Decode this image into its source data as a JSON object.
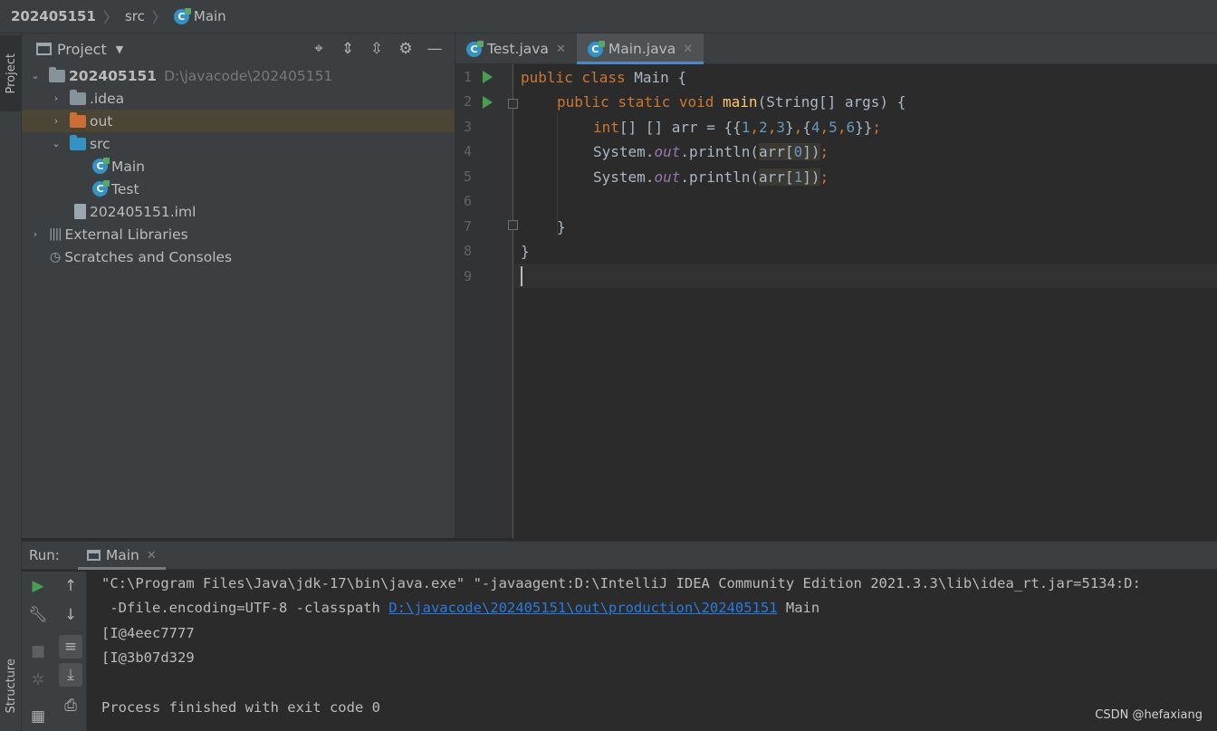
{
  "navbar": {
    "project": "202405151",
    "folder": "src",
    "file": "Main"
  },
  "left_strip": {
    "project_tab": "Project",
    "structure_tab": "Structure"
  },
  "project_panel": {
    "title": "Project",
    "tree": [
      {
        "label": "202405151",
        "path": "D:\\javacode\\202405151",
        "icon": "folder-icon"
      },
      {
        "label": ".idea",
        "icon": "folder-icon"
      },
      {
        "label": "out",
        "icon": "folder-orange-icon"
      },
      {
        "label": "src",
        "icon": "folder-blue-icon"
      },
      {
        "label": "Main",
        "icon": "java-class-icon"
      },
      {
        "label": "Test",
        "icon": "java-class-icon"
      },
      {
        "label": "202405151.iml",
        "icon": "iml-file-icon"
      },
      {
        "label": "External Libraries",
        "icon": "library-icon"
      },
      {
        "label": "Scratches and Consoles",
        "icon": "scratches-icon"
      }
    ]
  },
  "editor": {
    "tabs": [
      {
        "label": "Test.java",
        "active": false
      },
      {
        "label": "Main.java",
        "active": true
      }
    ],
    "line_numbers": [
      "1",
      "2",
      "3",
      "4",
      "5",
      "6",
      "7",
      "8",
      "9"
    ],
    "code": {
      "l1_kw": "public class ",
      "l1_rest": "Main {",
      "l2_kw": "public static void ",
      "l2_fn": "main",
      "l2_rest": "(String[] args) {",
      "l3_kw": "int",
      "l3_a": "[] [] arr = {{",
      "l3_n1": "1",
      "l3_c1": ",",
      "l3_n2": "2",
      "l3_c2": ",",
      "l3_n3": "3",
      "l3_b": "}",
      "l3_c3": ",",
      "l3_c": "{",
      "l3_n4": "4",
      "l3_c4": ",",
      "l3_n5": "5",
      "l3_c5": ",",
      "l3_n6": "6",
      "l3_d": "}}",
      "l3_semi": ";",
      "l4_a": "System.",
      "l4_out": "out",
      "l4_b": ".println(",
      "l4_arr": "arr[",
      "l4_idx": "0",
      "l4_c": "]",
      "l4_d": ")",
      "l4_semi": ";",
      "l5_a": "System.",
      "l5_out": "out",
      "l5_b": ".println(",
      "l5_arr": "arr[",
      "l5_idx": "1",
      "l5_c": "]",
      "l5_d": ")",
      "l5_semi": ";",
      "l7": "}",
      "l8": "}"
    }
  },
  "run_panel": {
    "label": "Run:",
    "tab": "Main",
    "output": {
      "line1": "\"C:\\Program Files\\Java\\jdk-17\\bin\\java.exe\" \"-javaagent:D:\\IntelliJ IDEA Community Edition 2021.3.3\\lib\\idea_rt.jar=5134:D:",
      "line2_a": " -Dfile.encoding=UTF-8 -classpath ",
      "line2_link": "D:\\javacode\\202405151\\out\\production\\202405151",
      "line2_b": " Main",
      "line3": "[I@4eec7777",
      "line4": "[I@3b07d329",
      "line5": "Process finished with exit code 0"
    }
  },
  "watermark": "CSDN @hefaxiang",
  "colors": {
    "keyword": "#cc7832",
    "function": "#ffc66d",
    "number": "#6897bb",
    "static_field": "#9876aa",
    "link": "#287bde",
    "accent_tab": "#4a88c7"
  }
}
